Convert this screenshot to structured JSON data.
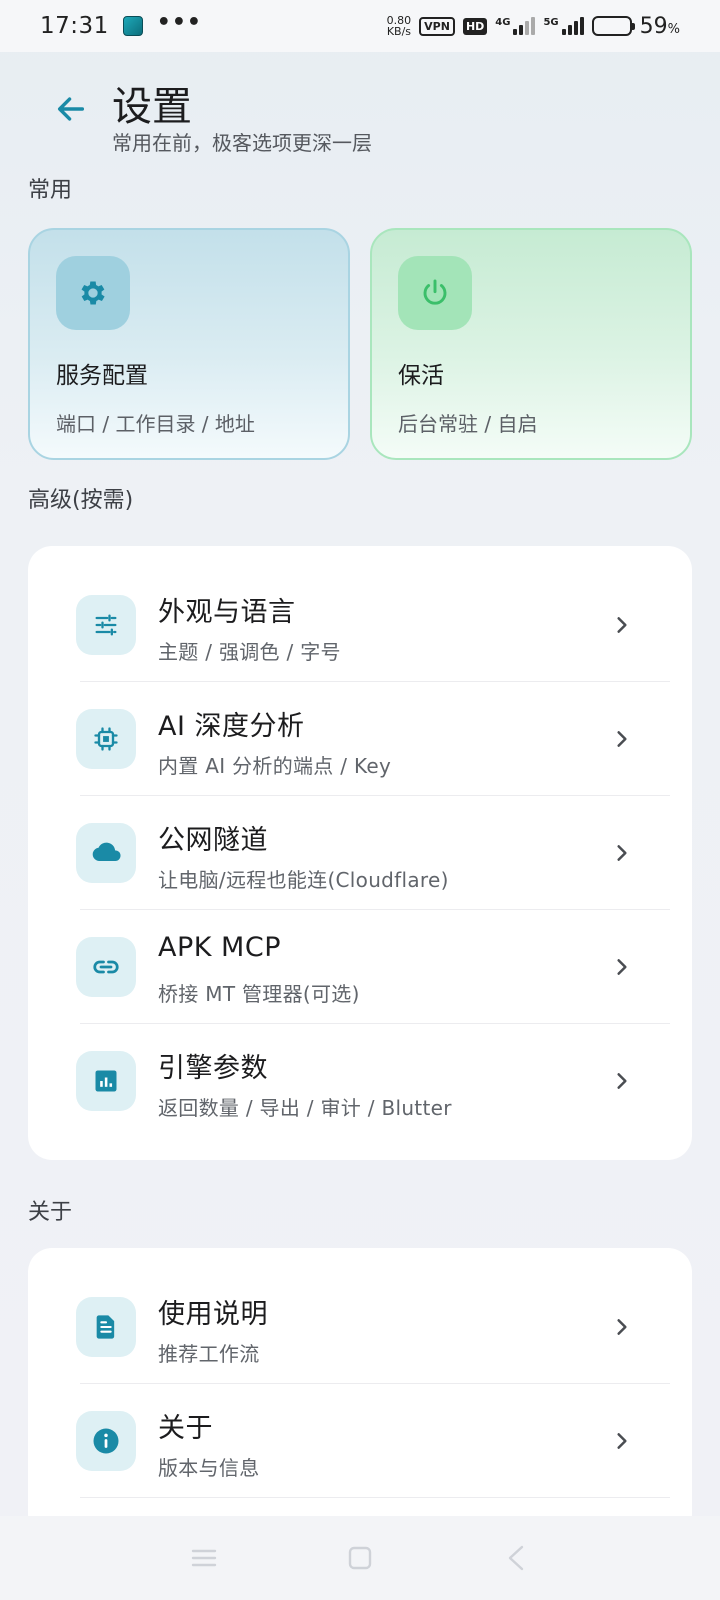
{
  "status_bar": {
    "time": "17:31",
    "dots": "•••",
    "speed_value": "0.80",
    "speed_unit": "KB/s",
    "vpn": "VPN",
    "hd": "HD",
    "net1": "4G",
    "net2": "5G",
    "battery_pct": "59",
    "battery_unit": "%",
    "battery_level": 0.59
  },
  "header": {
    "title": "设置",
    "subtitle": "常用在前，极客选项更深一层"
  },
  "sections": {
    "common": "常用",
    "advanced": "高级(按需)",
    "about": "关于"
  },
  "quick_cards": [
    {
      "title": "服务配置",
      "subtitle": "端口 / 工作目录 / 地址",
      "icon": "gear-icon",
      "accent": "#1a8aa6"
    },
    {
      "title": "保活",
      "subtitle": "后台常驻 / 自启",
      "icon": "power-icon",
      "accent": "#3bbf6a"
    }
  ],
  "advanced_items": [
    {
      "title": "外观与语言",
      "subtitle": "主题 / 强调色 / 字号",
      "icon": "sliders-icon"
    },
    {
      "title": "AI 深度分析",
      "subtitle": "内置 AI 分析的端点 / Key",
      "icon": "chip-icon"
    },
    {
      "title": "公网隧道",
      "subtitle": "让电脑/远程也能连(Cloudflare)",
      "icon": "cloud-icon"
    },
    {
      "title": "APK MCP",
      "subtitle": "桥接 MT 管理器(可选)",
      "icon": "link-icon"
    },
    {
      "title": "引擎参数",
      "subtitle": "返回数量 / 导出 / 审计 / Blutter",
      "icon": "chart-icon"
    }
  ],
  "about_items": [
    {
      "title": "使用说明",
      "subtitle": "推荐工作流",
      "icon": "document-icon"
    },
    {
      "title": "关于",
      "subtitle": "版本与信息",
      "icon": "info-icon"
    }
  ],
  "colors": {
    "accent": "#1a8aa6",
    "green": "#3bbf6a"
  }
}
